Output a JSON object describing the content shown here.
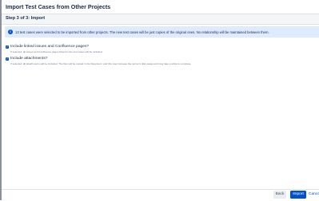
{
  "dialog": {
    "title": "Import Test Cases from Other Projects",
    "step_title": "Step 3 of 3: Import"
  },
  "info": {
    "icon": "info-icon",
    "icon_glyph": "i",
    "text": "13 test cases were selected to be imported from other projects. The new test cases will be just copies of the original ones. No relationship will be maintained between them."
  },
  "options": [
    {
      "checked": true,
      "label": "Include linked issues and Confluence pages?",
      "description": "If selected, all issues and Confluence pages linked to the test cases will be included."
    },
    {
      "checked": true,
      "label": "Include attachments?",
      "description": "If selected, all attachments will be included. The files will be copied in the filesystem, and this may increase the server's disk usage and may take a while to complete."
    }
  ],
  "footer": {
    "back_label": "Back",
    "import_label": "Import",
    "cancel_label": "Cancel"
  },
  "colors": {
    "primary": "#0052cc",
    "info_background": "#deebff",
    "text": "#172b4d"
  }
}
